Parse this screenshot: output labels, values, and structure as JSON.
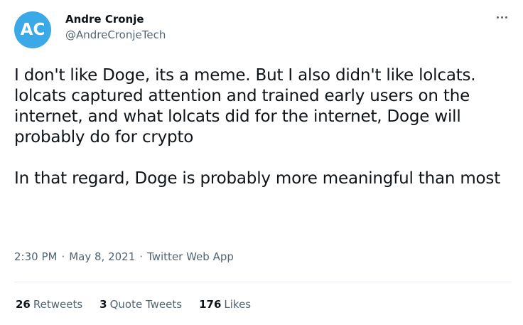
{
  "author": {
    "avatar_text": "AC",
    "avatar_color": "#3ba8e8",
    "display_name": "Andre Cronje",
    "handle": "@AndreCronjeTech"
  },
  "tweet": {
    "text": "I don't like Doge, its a meme. But I also didn't like lolcats.  lolcats captured attention and trained early users on the internet, and what lolcats did for the internet, Doge will probably do for crypto\n\nIn that regard, Doge is probably more meaningful than most"
  },
  "meta": {
    "time": "2:30 PM",
    "separator": "·",
    "date": "May 8, 2021",
    "source": "Twitter Web App"
  },
  "stats": {
    "retweets_count": "26",
    "retweets_label": "Retweets",
    "quotes_count": "3",
    "quotes_label": "Quote Tweets",
    "likes_count": "176",
    "likes_label": "Likes"
  },
  "icons": {
    "more": "more-options-icon"
  }
}
